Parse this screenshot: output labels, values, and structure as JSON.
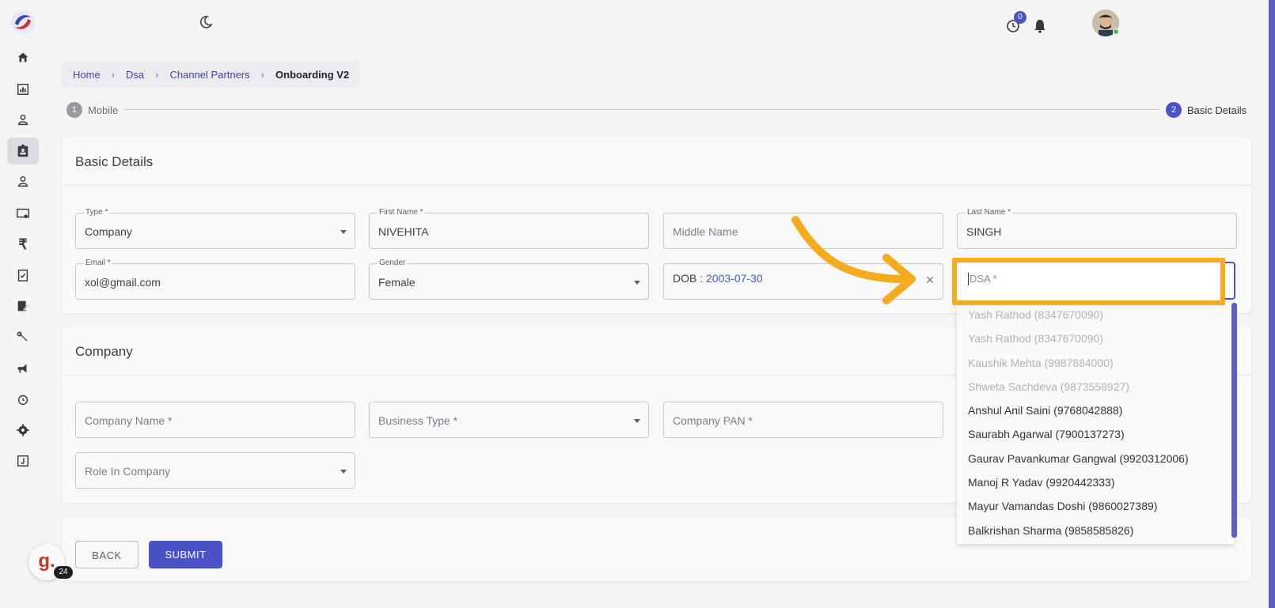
{
  "breadcrumb": {
    "items": [
      "Home",
      "Dsa",
      "Channel Partners"
    ],
    "current": "Onboarding V2"
  },
  "header": {
    "timer_badge": "0"
  },
  "stepper": {
    "step1": {
      "num": "1",
      "label": "Mobile"
    },
    "step2": {
      "num": "2",
      "label": "Basic Details"
    }
  },
  "basic_details": {
    "title": "Basic Details",
    "type": {
      "label": "Type *",
      "value": "Company"
    },
    "first_name": {
      "label": "First Name *",
      "value": "NIVEHITA"
    },
    "middle_name": {
      "placeholder": "Middle Name"
    },
    "last_name": {
      "label": "Last Name *",
      "value": "SINGH"
    },
    "email": {
      "label": "Email *",
      "value": "xol@gmail.com"
    },
    "gender": {
      "label": "Gender",
      "value": "Female"
    },
    "dob": {
      "label": "DOB :",
      "value": "2003-07-30"
    },
    "dsa": {
      "placeholder": "DSA *"
    }
  },
  "dsa_options": [
    {
      "text": "Yash Rathod (8347670090)",
      "disabled": true
    },
    {
      "text": "Yash Rathod (8347670090)",
      "disabled": true
    },
    {
      "text": "Kaushik Mehta (9987884000)",
      "disabled": true
    },
    {
      "text": "Shweta Sachdeva (9873558927)",
      "disabled": true
    },
    {
      "text": "Anshul Anil Saini (9768042888)",
      "disabled": false
    },
    {
      "text": "Saurabh Agarwal (7900137273)",
      "disabled": false
    },
    {
      "text": "Gaurav Pavankumar Gangwal (9920312006)",
      "disabled": false
    },
    {
      "text": "Manoj R Yadav (9920442333)",
      "disabled": false
    },
    {
      "text": "Mayur Vamandas Doshi (9860027389)",
      "disabled": false
    },
    {
      "text": "Balkrishan Sharma (9858585826)",
      "disabled": false
    }
  ],
  "company": {
    "title": "Company",
    "company_name": {
      "placeholder": "Company Name *"
    },
    "business_type": {
      "placeholder": "Business Type *"
    },
    "company_pan": {
      "placeholder": "Company PAN *"
    },
    "role": {
      "placeholder": "Role In Company"
    }
  },
  "actions": {
    "back": "BACK",
    "submit": "SUBMIT"
  },
  "widget": {
    "logo_letter": "g.",
    "count": "24"
  },
  "colors": {
    "accent": "#4a52c9",
    "highlight": "#f6ab1e"
  }
}
